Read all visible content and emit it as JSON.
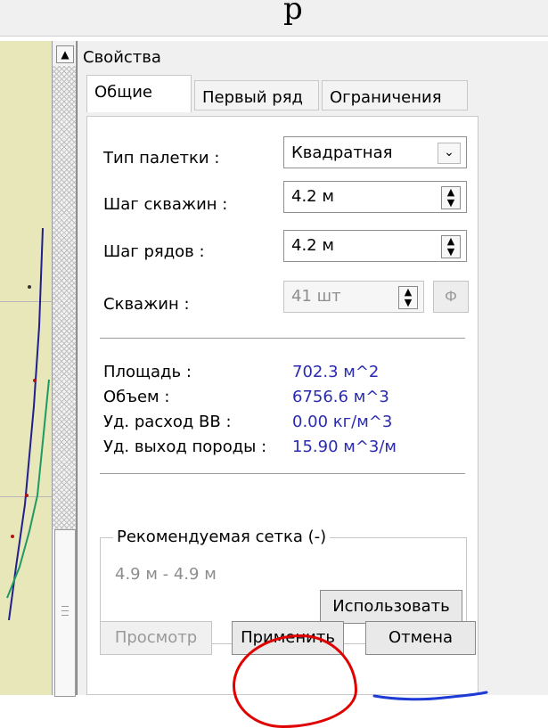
{
  "top": {
    "title": "р"
  },
  "panel": {
    "header": "Свойства",
    "tabs": [
      {
        "label": "Общие"
      },
      {
        "label": "Первый ряд"
      },
      {
        "label": "Ограничения"
      }
    ],
    "fields": {
      "palette_type": {
        "label": "Тип палетки :",
        "value": "Квадратная"
      },
      "well_step": {
        "label": "Шаг скважин :",
        "value": "4.2 м"
      },
      "row_step": {
        "label": "Шаг рядов :",
        "value": "4.2 м"
      },
      "wells": {
        "label": "Скважин :",
        "value": "41 шт",
        "fix_label": "Ф"
      }
    },
    "stats": [
      {
        "label": "Площадь :",
        "value": "702.3 м^2"
      },
      {
        "label": "Объем :",
        "value": "6756.6 м^3"
      },
      {
        "label": "Уд. расход ВВ :",
        "value": "0.00 кг/м^3"
      },
      {
        "label": "Уд. выход породы :",
        "value": "15.90 м^3/м"
      }
    ],
    "recommended": {
      "title": "Рекомендуемая сетка (-)",
      "range": "4.9  м - 4.9  м",
      "use_button": "Использовать"
    },
    "buttons": {
      "preview": "Просмотр",
      "apply": "Применить",
      "cancel": "Отмена"
    }
  },
  "colors": {
    "stats_value": "#2b2bb0",
    "highlight_circle": "#e00000",
    "underline": "#1f3bd6",
    "map_background": "#e7e7b9"
  }
}
